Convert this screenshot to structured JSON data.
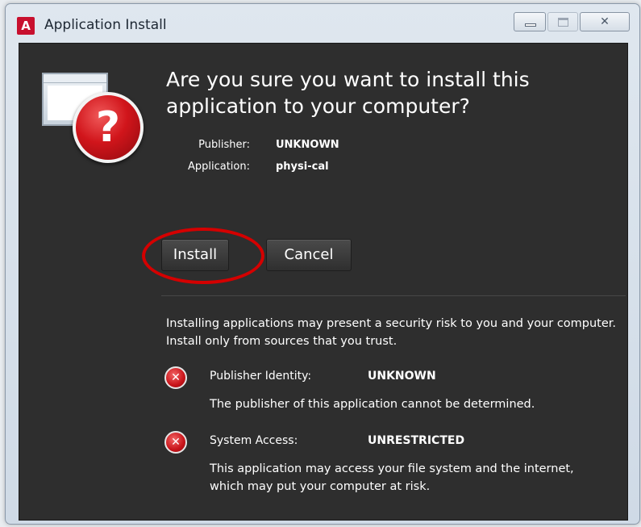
{
  "window": {
    "title": "Application Install",
    "app_logo_icon": "adobe-air-logo",
    "controls": {
      "minimize_icon": "minimize-icon",
      "maximize_icon": "maximize-icon",
      "close_glyph": "✕"
    }
  },
  "dialog": {
    "heading": "Are you sure you want to install this application to your computer?",
    "hero_icon": "question-icon",
    "publisher_label": "Publisher:",
    "publisher_value": "UNKNOWN",
    "application_label": "Application:",
    "application_value": "physi-cal",
    "install_label": "Install",
    "cancel_label": "Cancel",
    "highlight_color": "#d40000",
    "warning_text": "Installing applications may present a security risk to you and your computer. Install only from sources that you trust.",
    "risks": [
      {
        "icon": "error-icon",
        "glyph": "✕",
        "label": "Publisher Identity:",
        "value": "UNKNOWN",
        "description": "The publisher of this application cannot be determined."
      },
      {
        "icon": "error-icon",
        "glyph": "✕",
        "label": "System Access:",
        "value": "UNRESTRICTED",
        "description": "This application may access your file system and the internet, which may put your computer at risk."
      }
    ]
  },
  "colors": {
    "dialog_background": "#2e2e2e",
    "accent_red": "#c8141a"
  }
}
